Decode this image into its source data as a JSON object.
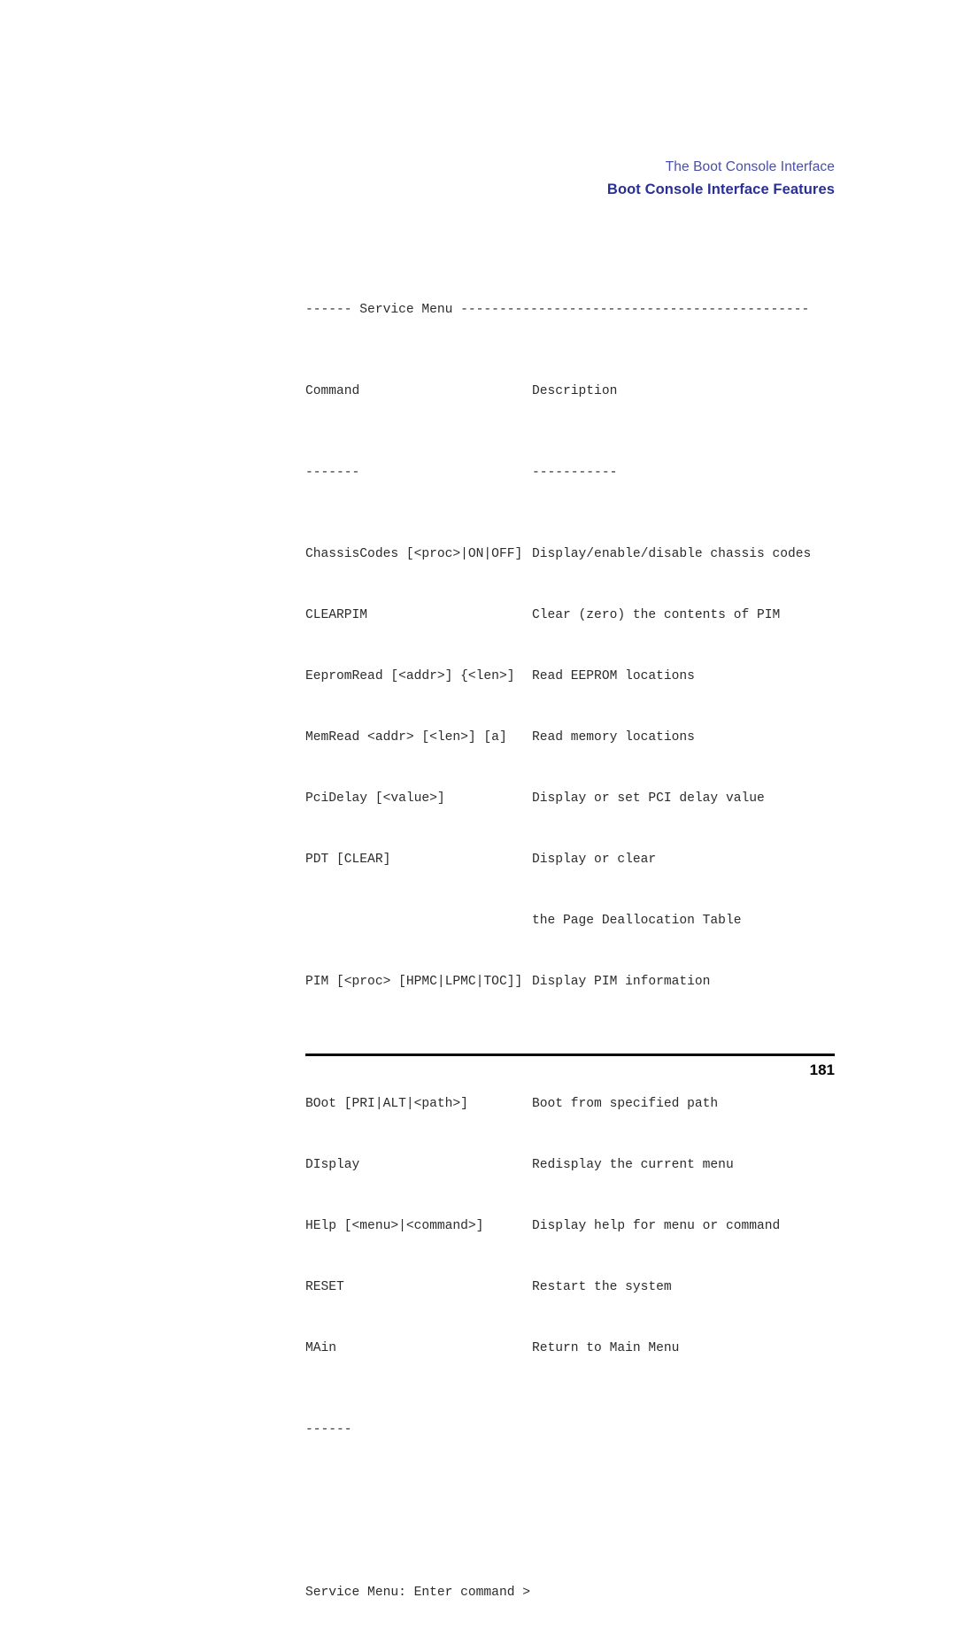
{
  "header": {
    "chapter": "The Boot Console Interface",
    "section": "Boot Console Interface Features",
    "chapter_color": "#4a4fa8",
    "section_color": "#2a2f96"
  },
  "console": {
    "menu_rule_top": "------ Service Menu ---------------------------------------------",
    "column_headers": {
      "command": "Command",
      "description": "Description"
    },
    "column_underlines": {
      "command": "-------",
      "description": "-----------"
    },
    "rows": [
      {
        "command": "ChassisCodes [<proc>|ON|OFF]",
        "description": "Display/enable/disable chassis codes"
      },
      {
        "command": "CLEARPIM",
        "description": "Clear (zero) the contents of PIM"
      },
      {
        "command": "EepromRead [<addr>] {<len>]",
        "description": "Read EEPROM locations"
      },
      {
        "command": "MemRead <addr> [<len>] [a]",
        "description": "Read memory locations"
      },
      {
        "command": "PciDelay [<value>]",
        "description": "Display or set PCI delay value"
      },
      {
        "command": "PDT [CLEAR]",
        "description": "Display or clear"
      },
      {
        "command": "",
        "description": "the Page Deallocation Table"
      },
      {
        "command": "PIM [<proc> [HPMC|LPMC|TOC]]",
        "description": "Display PIM information"
      },
      {
        "command": "",
        "description": ""
      },
      {
        "command": "BOot [PRI|ALT|<path>]",
        "description": "Boot from specified path"
      },
      {
        "command": "DIsplay",
        "description": "Redisplay the current menu"
      },
      {
        "command": "HElp [<menu>|<command>]",
        "description": "Display help for menu or command"
      },
      {
        "command": "RESET",
        "description": "Restart the system"
      },
      {
        "command": "MAin",
        "description": "Return to Main Menu"
      }
    ],
    "menu_rule_bottom": "------",
    "prompt": "Service Menu: Enter command >"
  },
  "footer": {
    "page_number": "181"
  }
}
